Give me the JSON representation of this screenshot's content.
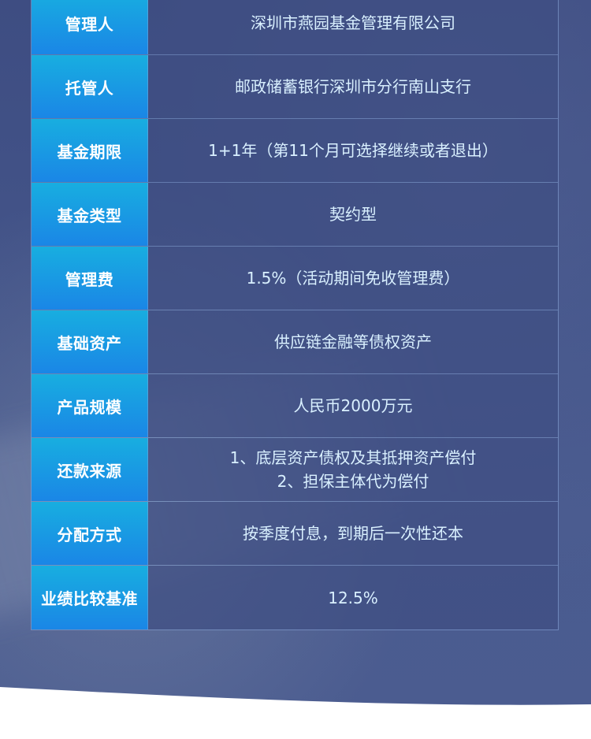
{
  "colors": {
    "label_gradient_top": "#18aee0",
    "label_gradient_bottom": "#1a86e6",
    "value_text": "#d9f0ff",
    "label_text": "#ffffff",
    "background": "#44558a",
    "bottom_band": "#ffffff"
  },
  "rows": [
    {
      "label": "管理人",
      "value": [
        "深圳市燕园基金管理有限公司"
      ]
    },
    {
      "label": "托管人",
      "value": [
        "邮政储蓄银行深圳市分行南山支行"
      ]
    },
    {
      "label": "基金期限",
      "value": [
        "1+1年（第11个月可选择继续或者退出）"
      ]
    },
    {
      "label": "基金类型",
      "value": [
        "契约型"
      ]
    },
    {
      "label": "管理费",
      "value": [
        "1.5%（活动期间免收管理费）"
      ]
    },
    {
      "label": "基础资产",
      "value": [
        "供应链金融等债权资产"
      ]
    },
    {
      "label": "产品规模",
      "value": [
        "人民币2000万元"
      ]
    },
    {
      "label": "还款来源",
      "value": [
        "1、底层资产债权及其抵押资产偿付",
        "2、担保主体代为偿付"
      ]
    },
    {
      "label": "分配方式",
      "value": [
        "按季度付息，到期后一次性还本"
      ]
    },
    {
      "label": "业绩比较基准",
      "value": [
        "12.5%"
      ]
    }
  ]
}
